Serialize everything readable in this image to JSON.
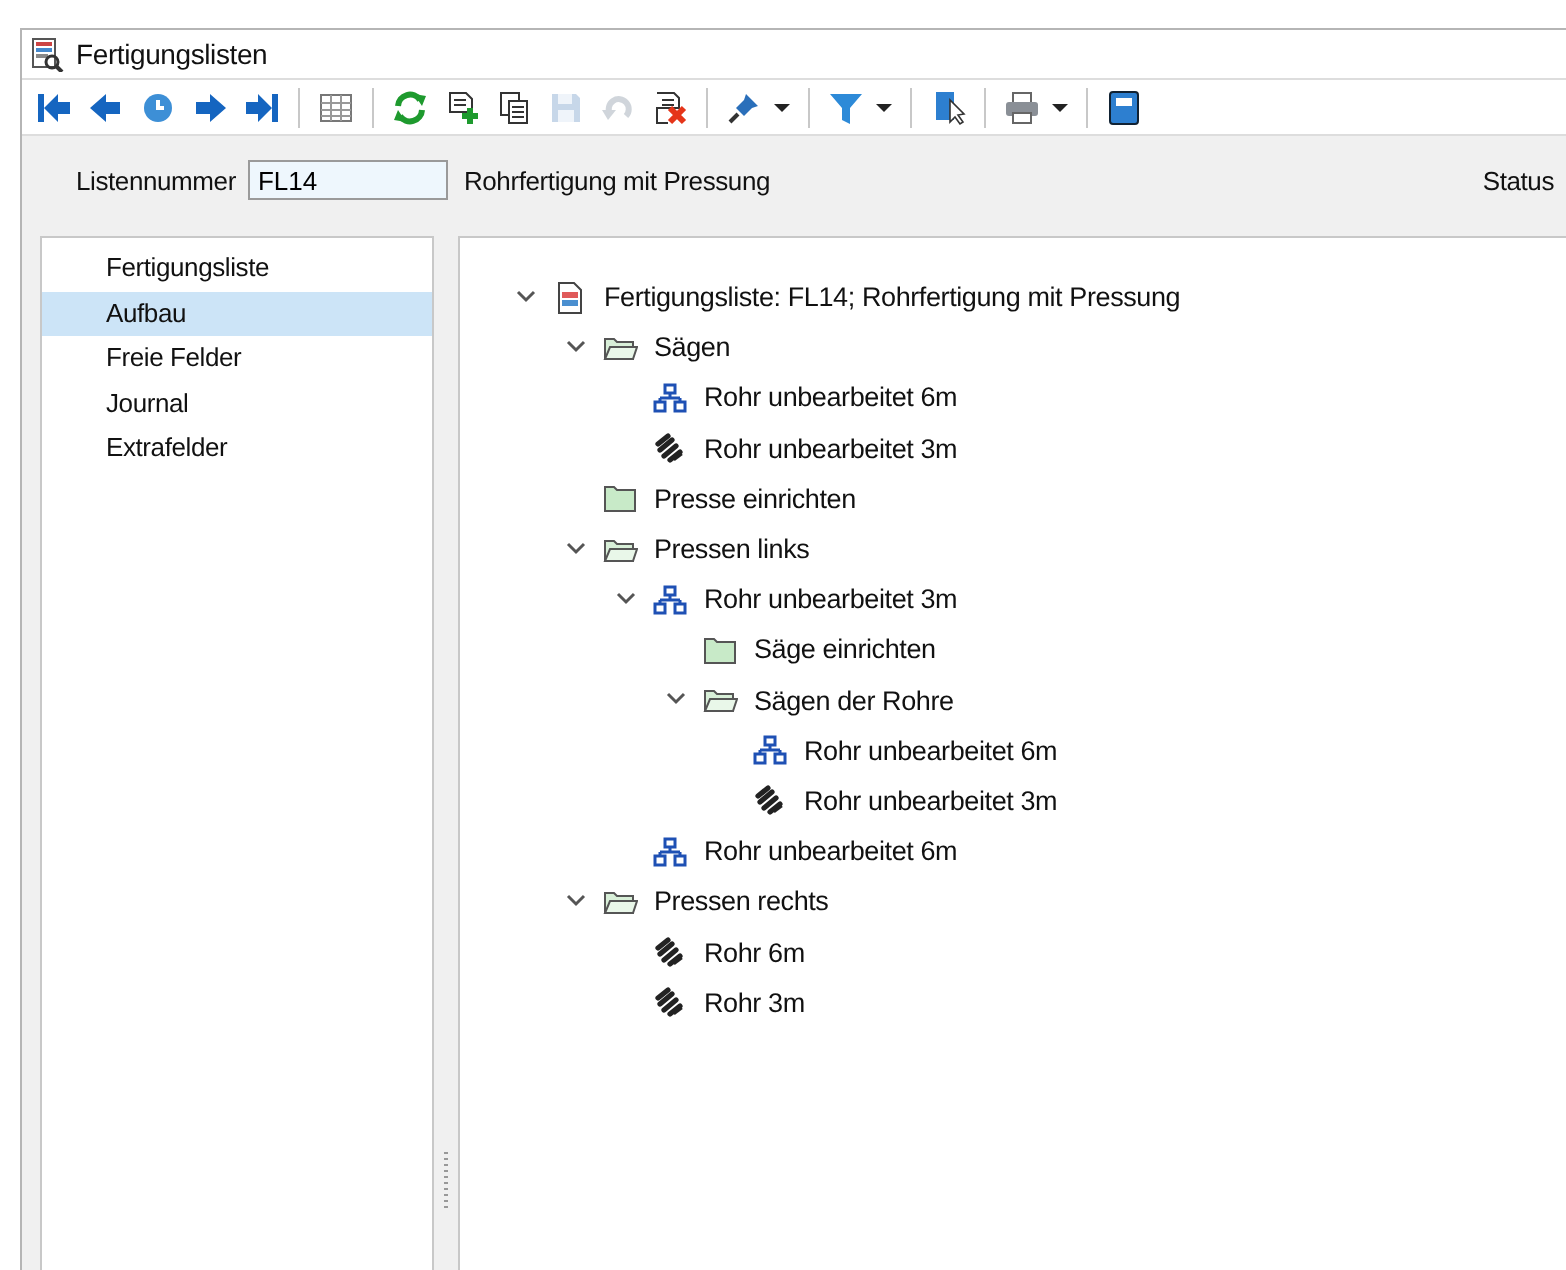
{
  "window": {
    "title": "Fertigungslisten"
  },
  "toolbar": [
    [
      {
        "kind": "first",
        "disabled": false,
        "dropdown": false
      },
      {
        "kind": "prev",
        "disabled": false,
        "dropdown": false
      },
      {
        "kind": "history",
        "disabled": false,
        "dropdown": false
      },
      {
        "kind": "next",
        "disabled": false,
        "dropdown": false
      },
      {
        "kind": "last",
        "disabled": false,
        "dropdown": false
      }
    ],
    [
      {
        "kind": "grid",
        "disabled": false,
        "dropdown": false
      }
    ],
    [
      {
        "kind": "refresh",
        "disabled": false,
        "dropdown": false
      },
      {
        "kind": "new",
        "disabled": false,
        "dropdown": false
      },
      {
        "kind": "copy",
        "disabled": false,
        "dropdown": false
      },
      {
        "kind": "save",
        "disabled": true,
        "dropdown": false
      },
      {
        "kind": "undo",
        "disabled": true,
        "dropdown": false
      },
      {
        "kind": "delete",
        "disabled": false,
        "dropdown": false
      }
    ],
    [
      {
        "kind": "pin",
        "disabled": false,
        "dropdown": true
      }
    ],
    [
      {
        "kind": "filter",
        "disabled": false,
        "dropdown": true
      }
    ],
    [
      {
        "kind": "export",
        "disabled": false,
        "dropdown": false
      }
    ],
    [
      {
        "kind": "print",
        "disabled": false,
        "dropdown": true
      }
    ],
    [
      {
        "kind": "book",
        "disabled": false,
        "dropdown": false
      }
    ]
  ],
  "header": {
    "label": "Listennummer",
    "value": "FL14",
    "description": "Rohrfertigung mit Pressung",
    "status_label": "Status"
  },
  "sidebar": {
    "items": [
      {
        "label": "Fertigungsliste",
        "selected": false
      },
      {
        "label": "Aufbau",
        "selected": true
      },
      {
        "label": "Freie Felder",
        "selected": false
      },
      {
        "label": "Journal",
        "selected": false
      },
      {
        "label": "Extrafelder",
        "selected": false
      }
    ]
  },
  "tree": [
    {
      "kind": "root",
      "label": "Fertigungsliste: FL14; Rohrfertigung mit Pressung",
      "expanded": true,
      "children": [
        {
          "kind": "folder",
          "label": "Sägen",
          "expanded": true,
          "children": [
            {
              "kind": "assembly",
              "label": "Rohr unbearbeitet 6m"
            },
            {
              "kind": "part",
              "label": "Rohr unbearbeitet 3m"
            }
          ]
        },
        {
          "kind": "folder",
          "label": "Presse einrichten",
          "expanded": false
        },
        {
          "kind": "folder",
          "label": "Pressen links",
          "expanded": true,
          "children": [
            {
              "kind": "assembly",
              "label": "Rohr unbearbeitet 3m",
              "expanded": true,
              "children": [
                {
                  "kind": "folder",
                  "label": "Säge einrichten",
                  "expanded": false
                },
                {
                  "kind": "folder",
                  "label": "Sägen der Rohre",
                  "expanded": true,
                  "children": [
                    {
                      "kind": "assembly",
                      "label": "Rohr unbearbeitet 6m"
                    },
                    {
                      "kind": "part",
                      "label": "Rohr unbearbeitet 3m"
                    }
                  ]
                }
              ]
            },
            {
              "kind": "assembly",
              "label": "Rohr unbearbeitet 6m"
            }
          ]
        },
        {
          "kind": "folder",
          "label": "Pressen rechts",
          "expanded": true,
          "children": [
            {
              "kind": "part",
              "label": "Rohr 6m"
            },
            {
              "kind": "part",
              "label": "Rohr 3m"
            }
          ]
        }
      ]
    }
  ]
}
